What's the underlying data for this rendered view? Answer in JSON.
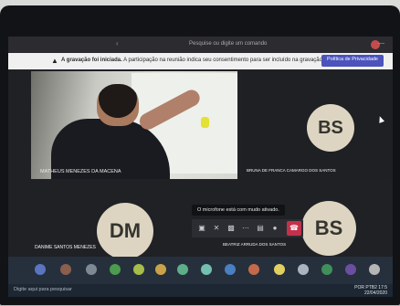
{
  "topbar": {
    "search_placeholder": "Pesquise ou digite um comando"
  },
  "banner": {
    "bold": "A gravação foi iniciada.",
    "text": "A participação na reunião indica seu consentimento para ser incluído na gravação da reunião.",
    "policy_button": "Política de Privacidade"
  },
  "participants": {
    "main_video_name": "MATHEUS MENEZES DA MACENA",
    "right_top_initials": "BS",
    "right_top_name": "BRUNA DE FRANCA CAMARGO DOS SANTOS",
    "bottom_left_initials": "DM",
    "bottom_left_name": "DANIME SANTOS MENEZES",
    "bottom_right_initials": "BS",
    "bottom_right_name": "BEATRIZ ARRUDA DOS SANTOS"
  },
  "controls": {
    "tooltip": "O microfone está com mudo ativado."
  },
  "taskbar": {
    "search": "Digite aqui para pesquisar",
    "time": "17:5",
    "date": "22/04/2020",
    "lang": "POR PTB2"
  },
  "colors": {
    "accent": "#4b53bc",
    "hangup": "#c4314b",
    "avatar_bg": "#ddd5c2"
  }
}
